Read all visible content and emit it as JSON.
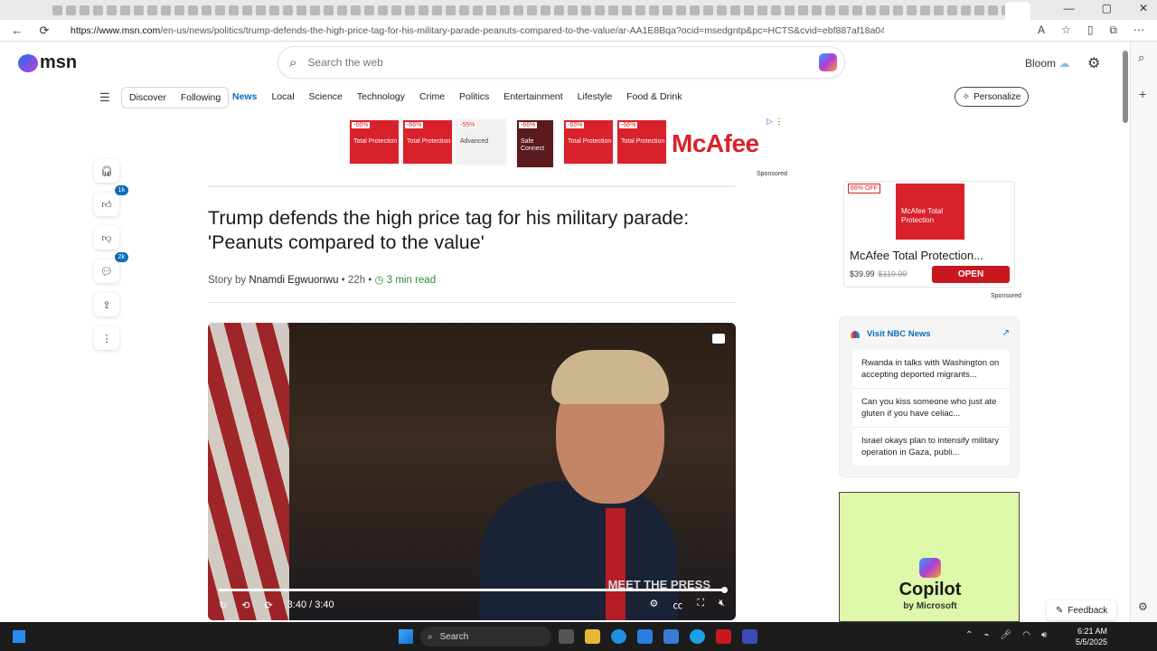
{
  "browser": {
    "url_prefix": "https://www.msn.com",
    "url_path": "/en-us/news/politics/trump-defends-the-high-price-tag-for-his-military-parade-peanuts-compared-to-the-value/ar-AA1E8Bqa?ocid=msedgntp&pc=HCTS&cvid=ebf887af18a047ffb0baf53b0a6..."
  },
  "header": {
    "logo_text": "msn",
    "search_placeholder": "Search the web",
    "user_label": "Bloom"
  },
  "nav": {
    "pills": [
      "Discover",
      "Following"
    ],
    "categories": [
      "News",
      "Local",
      "Science",
      "Technology",
      "Crime",
      "Politics",
      "Entertainment",
      "Lifestyle",
      "Food & Drink"
    ],
    "personalize": "Personalize"
  },
  "top_ad": {
    "brand": "McAfee",
    "sponsored": "Sponsored",
    "tiles": [
      {
        "pct": "-66%",
        "label": "Total Protection"
      },
      {
        "pct": "-66%",
        "label": "Total Protection"
      },
      {
        "pct": "-55%",
        "label": "Advanced"
      },
      {
        "pct": "-66%",
        "label": "Safe Connect"
      },
      {
        "pct": "-65%",
        "label": "Total Protection"
      },
      {
        "pct": "-66%",
        "label": "Total Protection"
      }
    ]
  },
  "actions": {
    "like_count": "1k",
    "comment_count": "2k"
  },
  "article": {
    "title": "Trump defends the high price tag for his military parade: 'Peanuts compared to the value'",
    "story_by": "Story by",
    "author": "Nnamdi Egwuonwu",
    "age": "22h",
    "read_time": "3 min read"
  },
  "video": {
    "time_current": "3:40",
    "time_total": "3:40",
    "watermark": "MEET THE PRESS",
    "progress": 1.0
  },
  "right_ad": {
    "discount": "66% OFF",
    "product_box": "McAfee Total Protection",
    "name": "McAfee Total Protection...",
    "price": "$39.99",
    "old_price": "$119.99",
    "cta": "OPEN",
    "sponsored": "Sponsored"
  },
  "nbc": {
    "title": "Visit NBC News",
    "items": [
      "Rwanda in talks with Washington on accepting deported migrants...",
      "Can you kiss someone who just ate gluten if you have celiac...",
      "Israel okays plan to intensify military operation in Gaza, publi..."
    ]
  },
  "copilot_ad": {
    "title": "Copilot",
    "subtitle": "by Microsoft"
  },
  "feedback": "Feedback",
  "taskbar": {
    "search": "Search",
    "time": "6:21 AM",
    "date": "5/5/2025"
  }
}
